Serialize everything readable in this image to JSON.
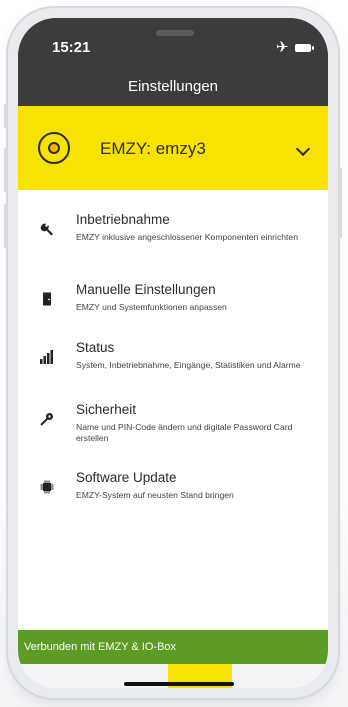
{
  "status_bar": {
    "time": "15:21"
  },
  "header": {
    "title": "Einstellungen"
  },
  "device": {
    "name": "EMZY: emzy3"
  },
  "menu": {
    "items": [
      {
        "title": "Inbetriebnahme",
        "desc": "EMZY inklusive angeschlossener Komponenten einrichten",
        "icon": "wrench-icon"
      },
      {
        "title": "Manuelle Einstellungen",
        "desc": "EMZY und Systemfunktionen anpassen",
        "icon": "door-icon"
      },
      {
        "title": "Status",
        "desc": "System, Inbetriebnahme, Eingänge, Statistiken und Alarme",
        "icon": "bar-chart-icon"
      },
      {
        "title": "Sicherheit",
        "desc": "Name und PIN-Code ändern und digitale Password Card erstellen",
        "icon": "key-icon"
      },
      {
        "title": "Software Update",
        "desc": "EMZY-System auf neusten Stand bringen",
        "icon": "chip-icon"
      }
    ]
  },
  "toast": {
    "text": "Verbunden mit EMZY & IO-Box"
  },
  "colors": {
    "accent": "#f8e200",
    "header_bg": "#3c3c3c",
    "toast_bg": "#5c9b25"
  }
}
